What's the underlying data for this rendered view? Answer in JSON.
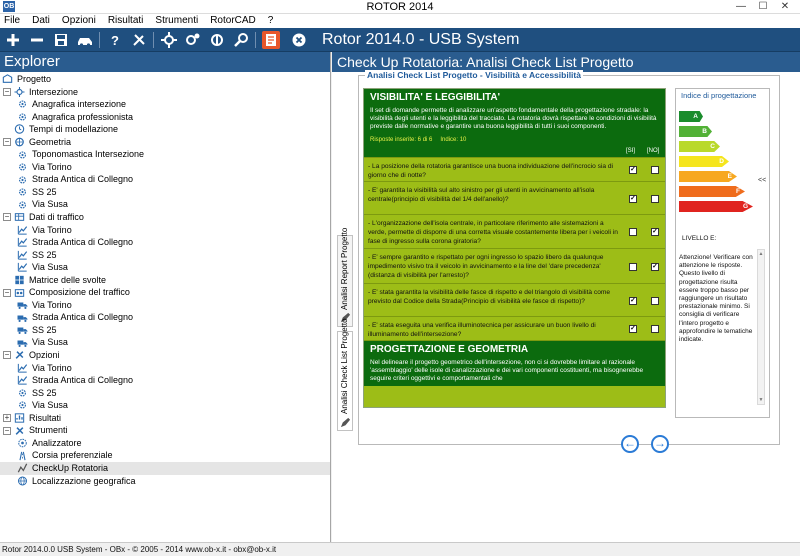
{
  "window": {
    "title": "ROTOR 2014",
    "app_icon": "OB",
    "minimize": "—",
    "maximize": "☐",
    "close": "✕"
  },
  "menu": [
    "File",
    "Dati",
    "Opzioni",
    "Risultati",
    "Strumenti",
    "RotorCAD",
    "?"
  ],
  "toolbar": {
    "system_title": "Rotor 2014.0 - USB System"
  },
  "explorer": {
    "title": "Explorer",
    "tree": [
      {
        "label": "Progetto",
        "level": 0,
        "icon": "project-icon",
        "expander": ""
      },
      {
        "label": "Intersezione",
        "level": 1,
        "icon": "intersection-icon",
        "expander": "−"
      },
      {
        "label": "Anagrafica intersezione",
        "level": 2,
        "icon": "gear-icon",
        "expander": ""
      },
      {
        "label": "Anagrafica professionista",
        "level": 2,
        "icon": "gear-icon",
        "expander": ""
      },
      {
        "label": "Tempi di modellazione",
        "level": 1,
        "icon": "clock-icon",
        "expander": ""
      },
      {
        "label": "Geometria",
        "level": 1,
        "icon": "geometry-icon",
        "expander": "−"
      },
      {
        "label": "Toponomastica Intersezione",
        "level": 2,
        "icon": "gear-icon",
        "expander": ""
      },
      {
        "label": "Via Torino",
        "level": 2,
        "icon": "gear-icon",
        "expander": ""
      },
      {
        "label": "Strada Antica di Collegno",
        "level": 2,
        "icon": "gear-icon",
        "expander": ""
      },
      {
        "label": "SS 25",
        "level": 2,
        "icon": "gear-icon",
        "expander": ""
      },
      {
        "label": "Via Susa",
        "level": 2,
        "icon": "gear-icon",
        "expander": ""
      },
      {
        "label": "Dati di traffico",
        "level": 1,
        "icon": "table-icon",
        "expander": "−"
      },
      {
        "label": "Via Torino",
        "level": 2,
        "icon": "chart-icon",
        "expander": ""
      },
      {
        "label": "Strada Antica di Collegno",
        "level": 2,
        "icon": "chart-icon",
        "expander": ""
      },
      {
        "label": "SS 25",
        "level": 2,
        "icon": "chart-icon",
        "expander": ""
      },
      {
        "label": "Via Susa",
        "level": 2,
        "icon": "chart-icon",
        "expander": ""
      },
      {
        "label": "Matrice delle svolte",
        "level": 1,
        "icon": "matrix-icon",
        "expander": ""
      },
      {
        "label": "Composizione del traffico",
        "level": 1,
        "icon": "traffic-icon",
        "expander": "−"
      },
      {
        "label": "Via Torino",
        "level": 2,
        "icon": "truck-icon",
        "expander": ""
      },
      {
        "label": "Strada Antica di Collegno",
        "level": 2,
        "icon": "truck-icon",
        "expander": ""
      },
      {
        "label": "SS 25",
        "level": 2,
        "icon": "truck-icon",
        "expander": ""
      },
      {
        "label": "Via Susa",
        "level": 2,
        "icon": "truck-icon",
        "expander": ""
      },
      {
        "label": "Opzioni",
        "level": 1,
        "icon": "tools-icon",
        "expander": "−"
      },
      {
        "label": "Via Torino",
        "level": 2,
        "icon": "chart-icon",
        "expander": ""
      },
      {
        "label": "Strada Antica di Collegno",
        "level": 2,
        "icon": "chart-icon",
        "expander": ""
      },
      {
        "label": "SS 25",
        "level": 2,
        "icon": "gear-icon",
        "expander": ""
      },
      {
        "label": "Via Susa",
        "level": 2,
        "icon": "gear-icon",
        "expander": ""
      },
      {
        "label": "Risultati",
        "level": 1,
        "icon": "results-icon",
        "expander": "+"
      },
      {
        "label": "Strumenti",
        "level": 1,
        "icon": "tools-icon",
        "expander": "−"
      },
      {
        "label": "Analizzatore",
        "level": 2,
        "icon": "analyzer-icon",
        "expander": ""
      },
      {
        "label": "Corsia preferenziale",
        "level": 2,
        "icon": "lane-icon",
        "expander": ""
      },
      {
        "label": "CheckUp Rotatoria",
        "level": 2,
        "icon": "checkup-icon",
        "expander": "",
        "selected": true
      },
      {
        "label": "Localizzazione geografica",
        "level": 2,
        "icon": "globe-icon",
        "expander": ""
      }
    ]
  },
  "main": {
    "title": "Check Up Rotatoria: Analisi Check List Progetto",
    "group_title": "Analisi Check List Progetto - Visibilità e Accessibilità",
    "vtabs": [
      {
        "label": "Analisi Report Progetto",
        "active": false
      },
      {
        "label": "Analisi Check List Progetto",
        "active": true
      }
    ],
    "section1": {
      "title": "VISIBILITA' E LEGGIBILITA'",
      "description": "Il set di domande permette di analizzare un'aspetto fondamentale della progettazione stradale: la visibilità degli utenti e la leggibilità del tracciato. La rotatoria dovrà rispettare le condizioni di visibilità previste dalle normative e garantire una buona leggibilità di tutti i suoi componenti.",
      "answers": "Risposte inserite: 6 di 6",
      "index": "Indice: 10",
      "col_si": "[SI]",
      "col_no": "[NO]"
    },
    "questions": [
      {
        "text": "- La posizione della rotatoria garantisce una buona individuazione dell'incrocio sia di giorno che di notte?",
        "si": "✓",
        "no": ""
      },
      {
        "text": "- E' garantita la visibilità sul alto sinistro per gli utenti in avvicinamento all'isola centrale(principio di visibilità del 1/4 dell'anello)?",
        "si": "✓",
        "no": ""
      },
      {
        "text": "- L'organizzazione dell'isola centrale, in particolare riferimento alle sistemazioni a verde, permette di disporre di una corretta visuale costantemente libera per i veicoli in fase di ingresso sulla corona giratoria?",
        "si": "",
        "no": "✓"
      },
      {
        "text": "- E' sempre garantito e rispettato per ogni ingresso lo spazio libero da qualunque impedimento visivo tra il veicolo in avvicinamento e la line del 'dare precedenza' (distanza di visibilità per l'arresto)?",
        "si": "",
        "no": "✓"
      },
      {
        "text": "- E' stata garantita la visibilità delle fasce di rispetto e del triangolo di visibilità come previsto dal Codice della Strada(Principio di visibilità ele fasce di rispetto)?",
        "si": "✓",
        "no": ""
      },
      {
        "text": "- E' stata eseguita una verifica illuminotecnica per assicurare un buon livello di illuminamento dell'intersezione?",
        "si": "✓",
        "no": ""
      }
    ],
    "section2": {
      "title": "PROGETTAZIONE E GEOMETRIA",
      "description": "Nel delineare il progetto geometrico dell'intersezione, non ci si dovrebbe limitare al razionale 'assemblaggio' delle isole di canalizzazione e dei vari componenti costituenti, ma bisognerebbe seguire criteri oggettivi e comportamentali che"
    },
    "index_panel": {
      "title": "Indice di progettazione",
      "grades": [
        {
          "label": "A",
          "color": "#1a8c2c"
        },
        {
          "label": "B",
          "color": "#52b136"
        },
        {
          "label": "C",
          "color": "#b9d92b"
        },
        {
          "label": "D",
          "color": "#f5e51d"
        },
        {
          "label": "E",
          "color": "#f7a820"
        },
        {
          "label": "F",
          "color": "#ef6c1c"
        },
        {
          "label": "G",
          "color": "#e0241f"
        }
      ],
      "current_marker": "<<",
      "level_label": "LIVELLO E:",
      "message": "Attenzione! Verificare con attenzione le risposte. Questo livello di progettazione risulta essere troppo basso per raggiungere un risultato prestazionale minimo. Si consiglia di verificare l'intero progetto e approfondire le tematiche indicate."
    },
    "nav": {
      "prev": "←",
      "next": "→"
    }
  },
  "status": "Rotor 2014.0.0 USB System - OBx - © 2005 - 2014 www.ob-x.it - obx@ob-x.it"
}
